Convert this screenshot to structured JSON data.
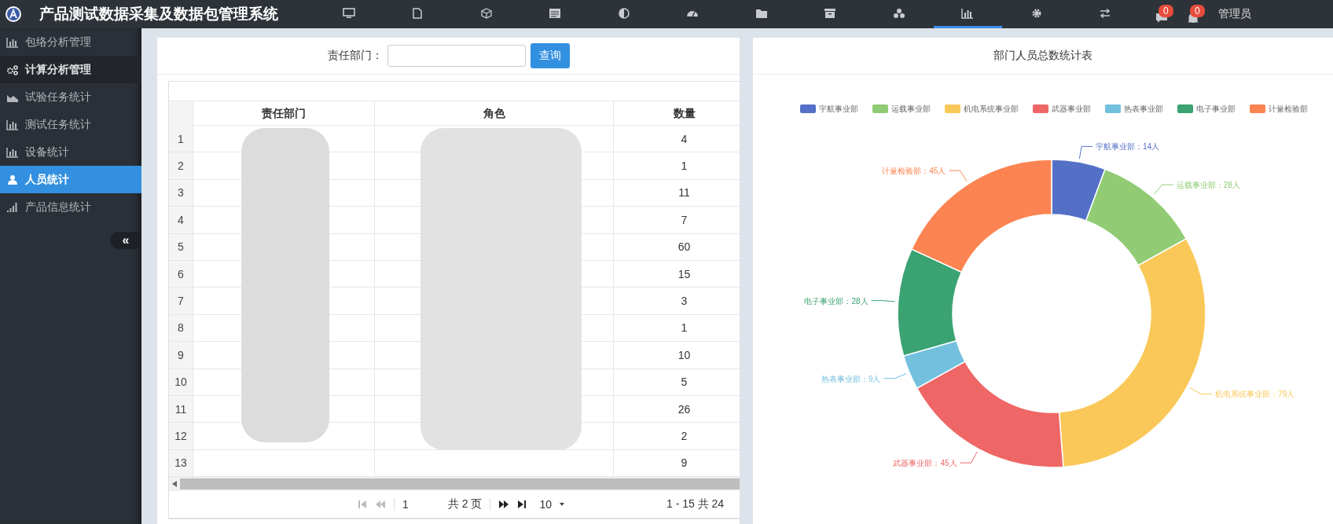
{
  "header": {
    "title": "产品测试数据采集及数据包管理系统",
    "nav": [
      {
        "kind": "monitor",
        "selected": false
      },
      {
        "kind": "file",
        "selected": false
      },
      {
        "kind": "cube",
        "selected": false
      },
      {
        "kind": "list",
        "selected": false
      },
      {
        "kind": "contrast",
        "selected": false
      },
      {
        "kind": "gauge",
        "selected": false
      },
      {
        "kind": "folder",
        "selected": false
      },
      {
        "kind": "archive",
        "selected": false
      },
      {
        "kind": "cubes",
        "selected": false
      },
      {
        "kind": "barchart",
        "selected": true
      },
      {
        "kind": "gear",
        "selected": false
      },
      {
        "kind": "exchange",
        "selected": false
      }
    ],
    "badges": [
      {
        "kind": "message",
        "count": "0"
      },
      {
        "kind": "bell",
        "count": "0"
      }
    ],
    "user": "管理员"
  },
  "sidebar": {
    "items": [
      {
        "label": "包络分析管理",
        "kind": "barchart",
        "selected": false,
        "highlighted": false
      },
      {
        "label": "计算分析管理",
        "kind": "gears",
        "selected": false,
        "highlighted": true
      },
      {
        "label": "试验任务统计",
        "kind": "area",
        "selected": false,
        "highlighted": false
      },
      {
        "label": "测试任务统计",
        "kind": "barchart",
        "selected": false,
        "highlighted": false
      },
      {
        "label": "设备统计",
        "kind": "barchart",
        "selected": false,
        "highlighted": false
      },
      {
        "label": "人员统计",
        "kind": "person",
        "selected": true,
        "highlighted": false
      },
      {
        "label": "产品信息统计",
        "kind": "signal",
        "selected": false,
        "highlighted": false
      }
    ],
    "collapse": "«"
  },
  "query": {
    "label": "责任部门：",
    "button": "查询"
  },
  "table": {
    "columns": [
      "责任部门",
      "角色",
      "数量"
    ],
    "rows": [
      {
        "index": "1",
        "count": "4"
      },
      {
        "index": "2",
        "count": "1"
      },
      {
        "index": "3",
        "count": "11"
      },
      {
        "index": "4",
        "count": "7"
      },
      {
        "index": "5",
        "count": "60"
      },
      {
        "index": "6",
        "count": "15"
      },
      {
        "index": "7",
        "count": "3"
      },
      {
        "index": "8",
        "count": "1"
      },
      {
        "index": "9",
        "count": "10"
      },
      {
        "index": "10",
        "count": "5"
      },
      {
        "index": "11",
        "count": "26"
      },
      {
        "index": "12",
        "count": "2"
      },
      {
        "index": "13",
        "count": "9"
      }
    ]
  },
  "pager": {
    "page": "1",
    "total_pages": "共 2 页",
    "page_size": "10",
    "summary": "1 - 15 共 24"
  },
  "chart_panel": {
    "title": "部门人员总数统计表",
    "chart_data": {
      "type": "donut",
      "categories": [
        "宇航事业部",
        "运载事业部",
        "机电系统事业部",
        "武器事业部",
        "热表事业部",
        "电子事业部",
        "计量检验部"
      ],
      "values": [
        14,
        28,
        79,
        45,
        9,
        28,
        45
      ],
      "legend": "top",
      "colors": [
        "#5470c6",
        "#91cc75",
        "#fac858",
        "#ee6666",
        "#73c0de",
        "#3ba272",
        "#fc8452"
      ],
      "value_labels": [
        "宇航事业部：14人",
        "运载事业部：28人",
        "机电系统事业部：79人",
        "武器事业部：45人",
        "热表事业部：9人",
        "电子事业部：28人",
        "计量检验部：45人"
      ]
    }
  }
}
